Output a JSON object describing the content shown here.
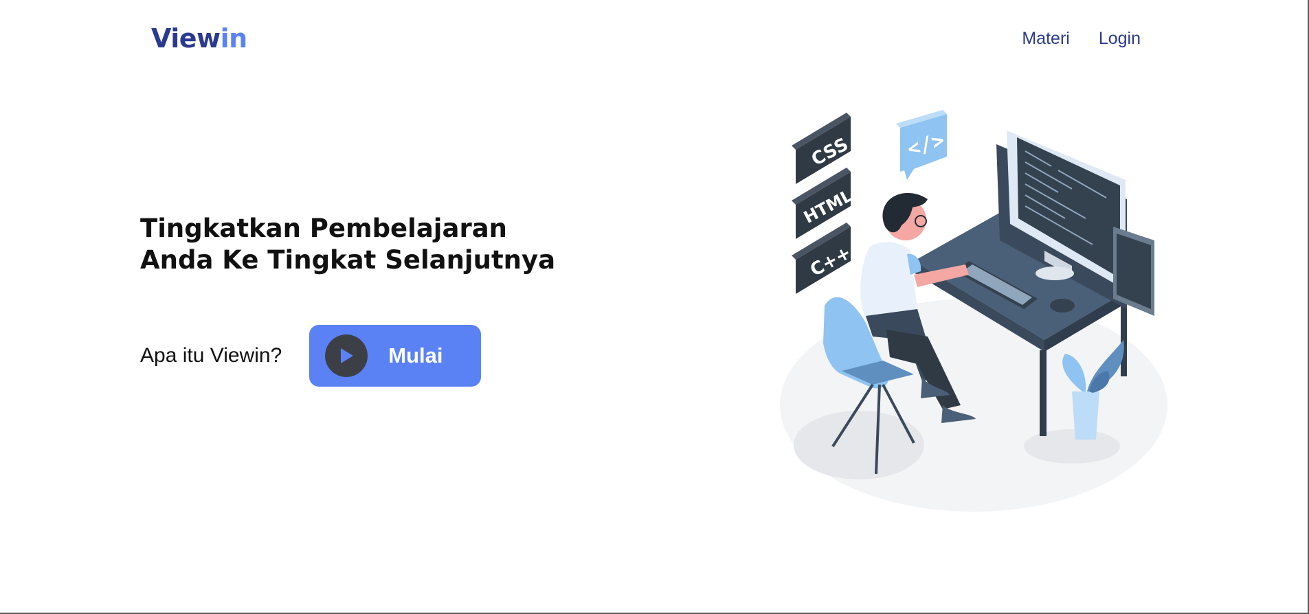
{
  "nav": {
    "logo_primary": "View",
    "logo_accent": "in",
    "links": [
      {
        "label": "Materi"
      },
      {
        "label": "Login"
      }
    ]
  },
  "hero": {
    "headline_line1": "Tingkatkan Pembelajaran",
    "headline_line2": "Anda Ke Tingkat Selanjutnya",
    "question": "Apa itu Viewin?",
    "button_label": "Mulai"
  },
  "illustration": {
    "badges": [
      "CSS",
      "HTML",
      "C++"
    ],
    "code_bubble": "</>"
  },
  "colors": {
    "brand_dark": "#2b3a8f",
    "brand_accent": "#5b82f5",
    "button_icon_bg": "#3d3f47"
  },
  "icons": [
    "play-icon"
  ]
}
